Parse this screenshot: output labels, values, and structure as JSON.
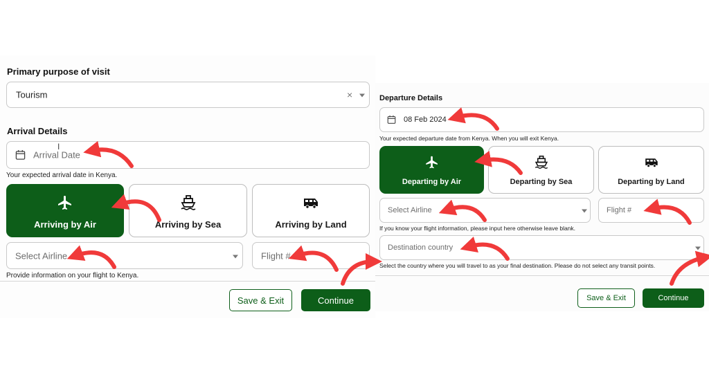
{
  "left": {
    "purpose_label": "Primary purpose of visit",
    "purpose_value": "Tourism",
    "arrival_heading": "Arrival Details",
    "arrival_placeholder": "Arrival Date",
    "arrival_helper": "Your expected arrival date in Kenya.",
    "modes": [
      {
        "label": "Arriving by Air",
        "icon": "plane-icon",
        "selected": true
      },
      {
        "label": "Arriving by Sea",
        "icon": "ship-icon",
        "selected": false
      },
      {
        "label": "Arriving by Land",
        "icon": "bus-icon",
        "selected": false
      }
    ],
    "airline_placeholder": "Select Airline",
    "flight_placeholder": "Flight #",
    "flight_helper": "Provide information on your flight to Kenya.",
    "save_label": "Save & Exit",
    "continue_label": "Continue"
  },
  "right": {
    "departure_heading": "Departure Details",
    "departure_date": "08 Feb 2024",
    "departure_helper": "Your expected departure date from Kenya. When you will exit Kenya.",
    "modes": [
      {
        "label": "Departing by Air",
        "icon": "plane-icon",
        "selected": true
      },
      {
        "label": "Departing by Sea",
        "icon": "ship-icon",
        "selected": false
      },
      {
        "label": "Departing by Land",
        "icon": "bus-icon",
        "selected": false
      }
    ],
    "airline_placeholder": "Select Airline",
    "flight_placeholder": "Flight #",
    "flight_helper": "If you know your flight information, please input here otherwise leave blank.",
    "destination_placeholder": "Destination country",
    "destination_helper": "Select the country where you will travel to as your final destination. Please do not select any transit points.",
    "save_label": "Save & Exit",
    "continue_label": "Continue"
  },
  "colors": {
    "brand_green": "#0d5e19",
    "annotation_red": "#f03a3a"
  }
}
